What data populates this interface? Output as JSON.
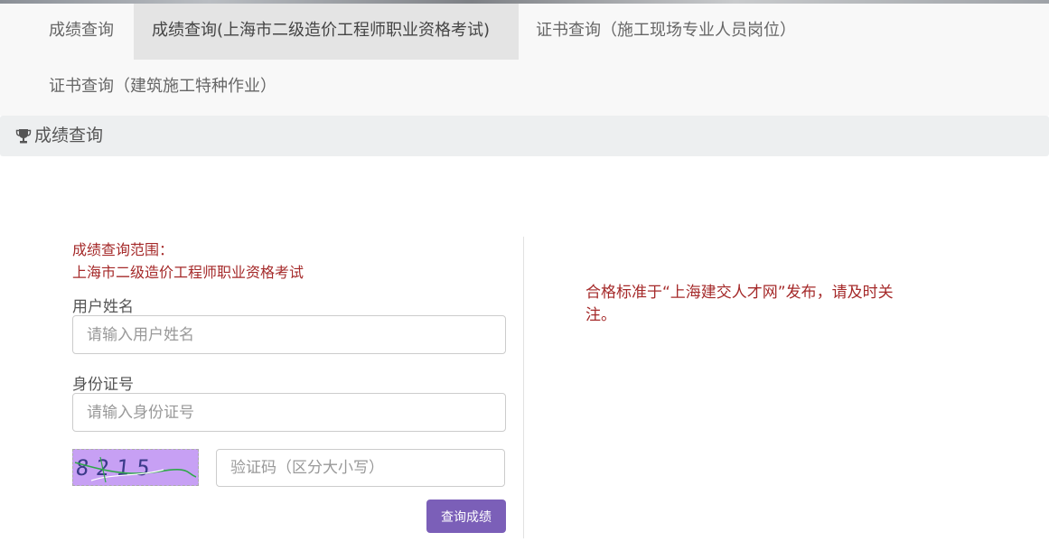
{
  "nav": {
    "tabs": [
      {
        "label": "成绩查询",
        "active": false
      },
      {
        "label": "成绩查询(上海市二级造价工程师职业资格考试)",
        "active": true
      },
      {
        "label": "证书查询（施工现场专业人员岗位）",
        "active": false
      },
      {
        "label": "证书查询（建筑施工特种作业）",
        "active": false
      }
    ]
  },
  "panel": {
    "title": "成绩查询",
    "icon": "trophy-icon"
  },
  "form": {
    "scope_label": "成绩查询范围：",
    "scope_value": "上海市二级造价工程师职业资格考试",
    "name_label": "用户姓名",
    "name_placeholder": "请输入用户姓名",
    "id_label": "身份证号",
    "id_placeholder": "请输入身份证号",
    "captcha_text": "8215",
    "captcha_placeholder": "验证码（区分大小写）",
    "submit_label": "查询成绩"
  },
  "notice": {
    "text": "合格标准于“上海建交人才网”发布，请及时关注。"
  },
  "colors": {
    "accent_button": "#7b5fb8",
    "notice_text": "#a52a2a",
    "captcha_bg": "#c7a0f4"
  }
}
